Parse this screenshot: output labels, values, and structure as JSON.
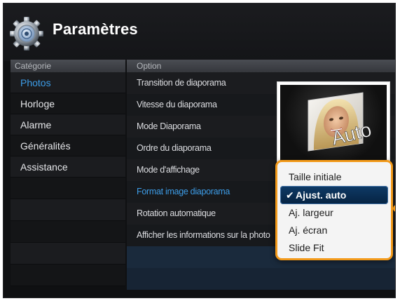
{
  "header": {
    "title": "Paramètres",
    "icon": "gear-icon"
  },
  "columns": {
    "category": "Catégorie",
    "option": "Option"
  },
  "categories": [
    {
      "label": "Photos",
      "active": true
    },
    {
      "label": "Horloge"
    },
    {
      "label": "Alarme"
    },
    {
      "label": "Généralités"
    },
    {
      "label": "Assistance"
    }
  ],
  "options": [
    {
      "label": "Transition de diaporama"
    },
    {
      "label": "Vitesse du diaporama"
    },
    {
      "label": "Mode Diaporama"
    },
    {
      "label": "Ordre du diaporama"
    },
    {
      "label": "Mode d'affichage"
    },
    {
      "label": "Format image diaporama",
      "active": true
    },
    {
      "label": "Rotation automatique"
    },
    {
      "label": "Afficher les informations sur la photo"
    }
  ],
  "preview": {
    "label": "Auto"
  },
  "dropdown": {
    "items": [
      {
        "label": "Taille initiale"
      },
      {
        "label": "Ajust. auto",
        "selected": true
      },
      {
        "label": "Aj. largeur"
      },
      {
        "label": "Aj. écran"
      },
      {
        "label": "Slide Fit"
      }
    ]
  },
  "colors": {
    "accent_blue": "#3d9de8",
    "popup_border": "#f39a1a",
    "selected_bg": "#0e3a66"
  }
}
